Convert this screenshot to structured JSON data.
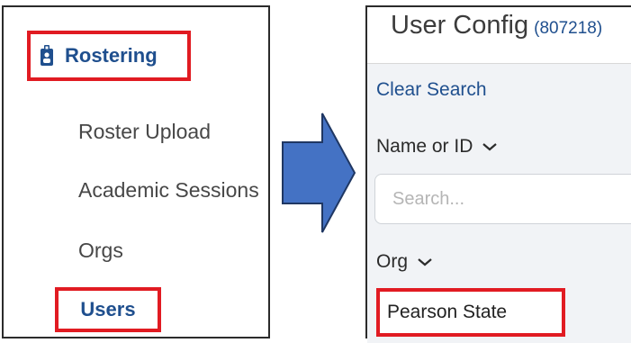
{
  "sidebar": {
    "section": {
      "label": "Rostering",
      "icon": "badge-icon"
    },
    "items": [
      {
        "label": "Roster Upload"
      },
      {
        "label": "Academic Sessions"
      },
      {
        "label": "Orgs"
      },
      {
        "label": "Users",
        "highlighted": true
      }
    ]
  },
  "user_config": {
    "title": "User Config",
    "id_text": "(807218)",
    "clear_search": "Clear Search",
    "name_filter": {
      "label": "Name or ID",
      "icon": "chevron-down-icon"
    },
    "search": {
      "placeholder": "Search..."
    },
    "org_filter": {
      "label": "Org",
      "icon": "chevron-down-icon",
      "selected": "Pearson State"
    }
  },
  "colors": {
    "accent_blue": "#1f4f8e",
    "highlight_red": "#e11b22",
    "arrow_fill": "#4472c4",
    "arrow_stroke": "#1f3763"
  }
}
